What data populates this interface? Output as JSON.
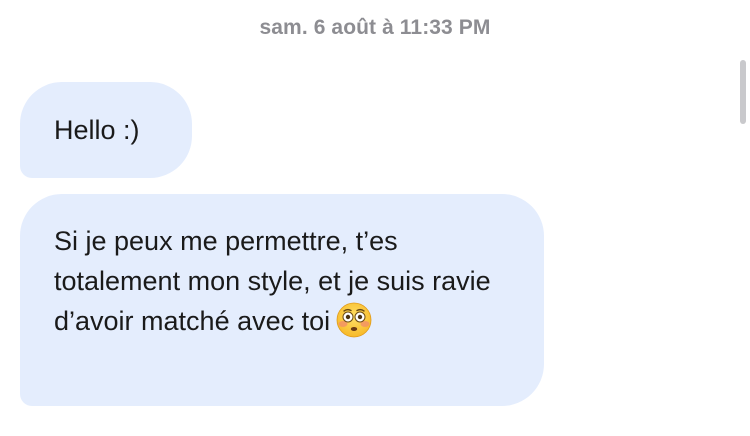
{
  "chat": {
    "timestamp": "sam. 6 août à 11:33 PM",
    "messages": [
      {
        "text": "Hello :)"
      },
      {
        "text": "Si je peux me permettre, t’es totalement mon style, et je suis ravie d’avoir matché avec toi",
        "emoji": "flushed-face-emoji"
      }
    ]
  },
  "colors": {
    "bubble_background": "#e4edfd",
    "timestamp_text": "#8d8d92",
    "message_text": "#1a1a1a"
  }
}
